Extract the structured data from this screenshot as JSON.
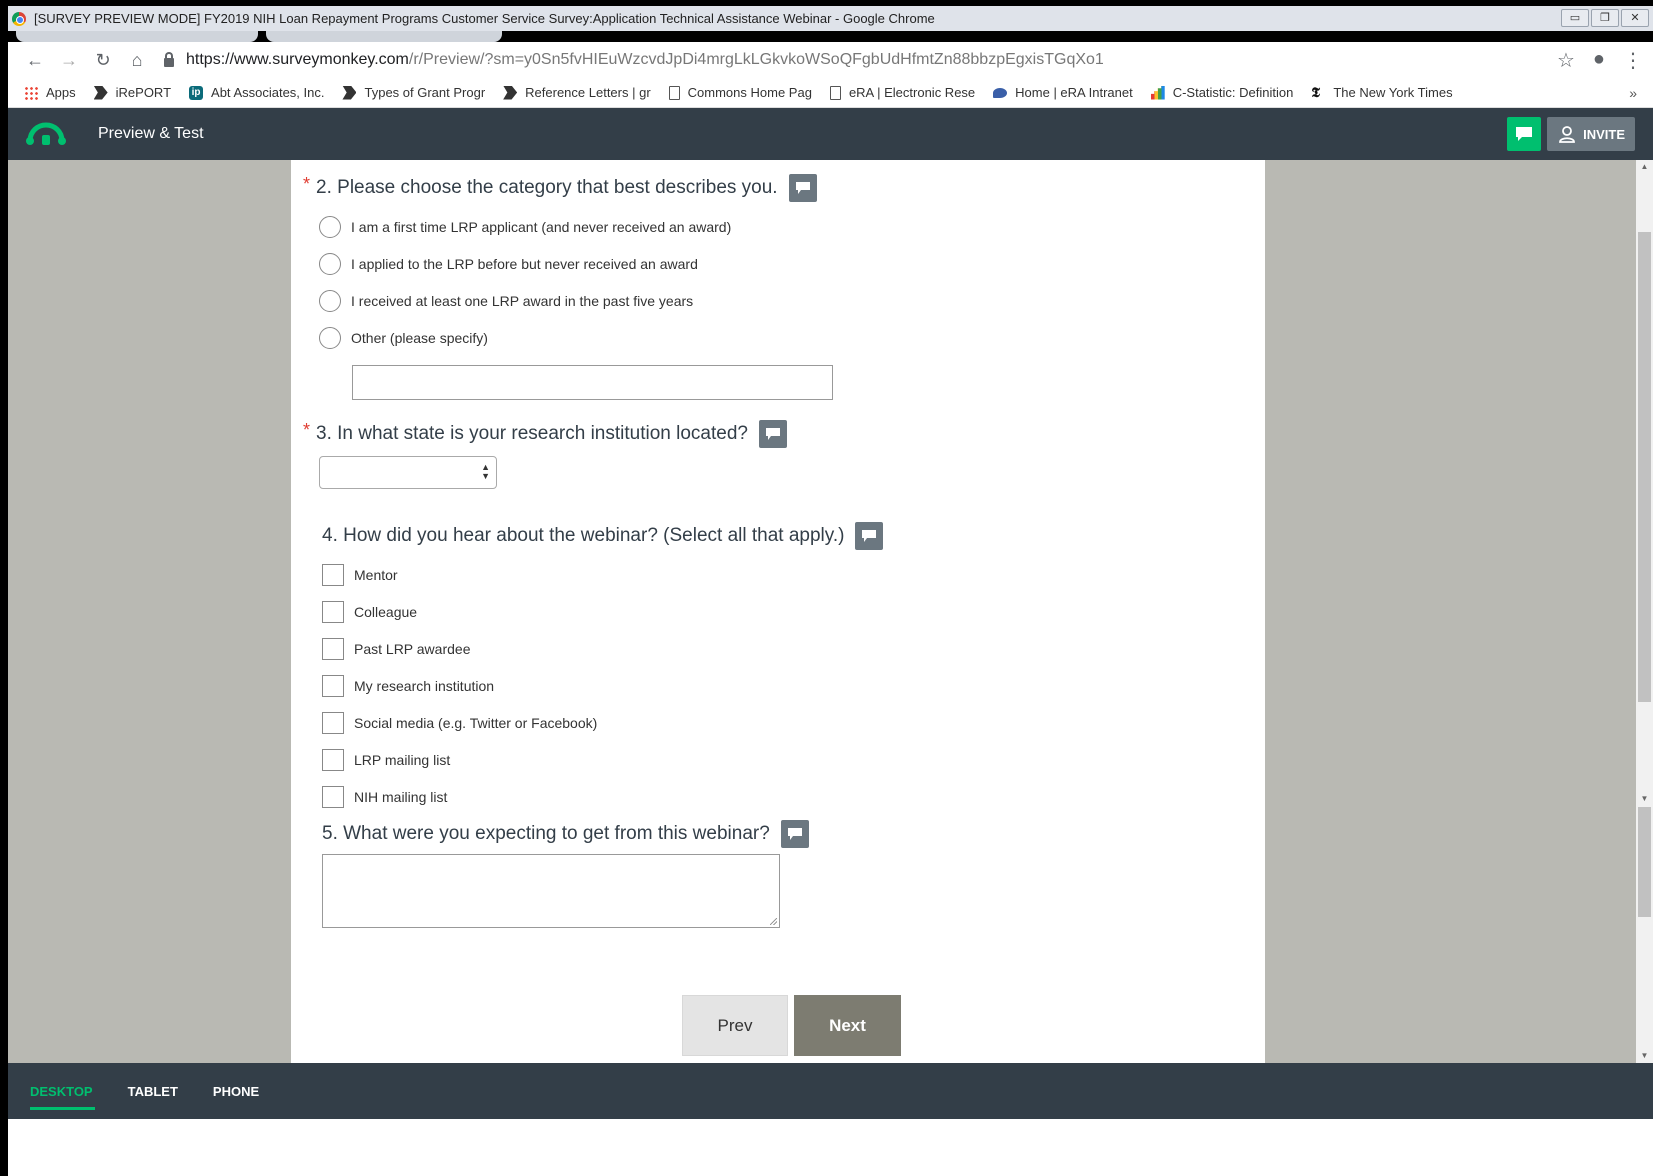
{
  "browser": {
    "window_title": "[SURVEY PREVIEW MODE] FY2019 NIH Loan Repayment Programs Customer Service Survey:Application Technical Assistance Webinar - Google Chrome",
    "url_host": "https://www.surveymonkey.com",
    "url_path": "/r/Preview/?sm=y0Sn5fvHIEuWzcvdJpDi4mrgLkLGkvkoWSoQFgbUdHfmtZn88bbzpEgxisTGqXo1",
    "bookmarks": [
      {
        "label": "Apps",
        "icon": "apps-grid-icon"
      },
      {
        "label": "iRePORT",
        "icon": "flag-icon"
      },
      {
        "label": "Abt Associates, Inc.",
        "icon": "ip-icon"
      },
      {
        "label": "Types of Grant Progr",
        "icon": "flag-icon"
      },
      {
        "label": "Reference Letters | gr",
        "icon": "flag-icon"
      },
      {
        "label": "Commons Home Pag",
        "icon": "document-icon"
      },
      {
        "label": "eRA | Electronic Rese",
        "icon": "document-icon"
      },
      {
        "label": "Home | eRA Intranet",
        "icon": "era-icon"
      },
      {
        "label": "C-Statistic: Definition",
        "icon": "chart-icon"
      },
      {
        "label": "The New York Times",
        "icon": "nyt-icon"
      }
    ],
    "more": "»"
  },
  "app": {
    "title": "Preview & Test",
    "invite_label": "INVITE",
    "accent": "#00bf6f",
    "header_bg": "#333e48"
  },
  "survey": {
    "q2": {
      "required": "*",
      "title": "2. Please choose the category that best describes you.",
      "options": [
        "I am a first time LRP applicant (and never received an award)",
        "I applied to the LRP before but never received an award",
        "I received at least one LRP award in the past five years",
        "Other (please specify)"
      ],
      "other_value": ""
    },
    "q3": {
      "required": "*",
      "title": "3. In what state is your research institution located?",
      "selected": ""
    },
    "q4": {
      "title": "4. How did you hear about the webinar? (Select all that apply.)",
      "options": [
        "Mentor",
        "Colleague",
        "Past LRP awardee",
        "My research institution",
        "Social media (e.g. Twitter or Facebook)",
        "LRP mailing list",
        "NIH mailing list"
      ]
    },
    "q5": {
      "title": "5. What were you expecting to get from this webinar?",
      "value": ""
    },
    "prev_label": "Prev",
    "next_label": "Next"
  },
  "device_tabs": [
    {
      "label": "DESKTOP",
      "active": true
    },
    {
      "label": "TABLET",
      "active": false
    },
    {
      "label": "PHONE",
      "active": false
    }
  ]
}
